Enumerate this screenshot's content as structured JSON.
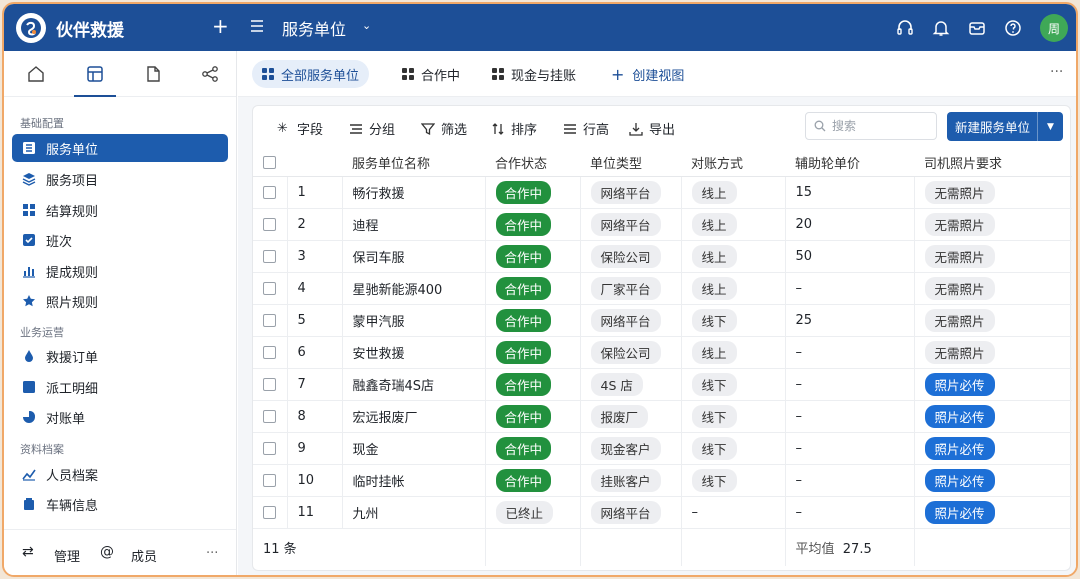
{
  "app": {
    "title": "伙伴救援",
    "view_title": "服务单位",
    "avatar": "周"
  },
  "colors": {
    "brand": "#1d4f97",
    "accent": "#1d5cad",
    "status_green": "#22913e",
    "photo_blue": "#1d6fd6"
  },
  "sidebar": {
    "tabs": [
      "home-icon",
      "table-icon",
      "document-icon",
      "share-icon"
    ],
    "sections": [
      {
        "title": "基础配置",
        "items": [
          {
            "label": "服务单位",
            "icon": "list-icon",
            "active": true
          },
          {
            "label": "服务项目",
            "icon": "layers-icon"
          },
          {
            "label": "结算规则",
            "icon": "grid-icon"
          },
          {
            "label": "班次",
            "icon": "checkbox-icon"
          },
          {
            "label": "提成规则",
            "icon": "bar-chart-icon"
          },
          {
            "label": "照片规则",
            "icon": "star-icon"
          }
        ]
      },
      {
        "title": "业务运营",
        "items": [
          {
            "label": "救援订单",
            "icon": "drop-icon"
          },
          {
            "label": "派工明细",
            "icon": "square-icon"
          },
          {
            "label": "对账单",
            "icon": "pie-icon"
          }
        ]
      },
      {
        "title": "资料档案",
        "items": [
          {
            "label": "人员档案",
            "icon": "trend-icon"
          },
          {
            "label": "车辆信息",
            "icon": "box-icon"
          }
        ]
      }
    ],
    "footer": {
      "manage": "管理",
      "members": "成员",
      "more": "···"
    }
  },
  "view_tabs": [
    {
      "label": "全部服务单位",
      "active": true
    },
    {
      "label": "合作中"
    },
    {
      "label": "现金与挂账"
    },
    {
      "label": "创建视图"
    }
  ],
  "toolbar": {
    "fields": "字段",
    "group": "分组",
    "filter": "筛选",
    "sort": "排序",
    "row_height": "行高",
    "export": "导出",
    "search_placeholder": "搜索",
    "new_button": "新建服务单位"
  },
  "table": {
    "columns": [
      "服务单位名称",
      "合作状态",
      "单位类型",
      "对账方式",
      "辅助轮单价",
      "司机照片要求"
    ],
    "rows": [
      {
        "no": "1",
        "name": "畅行救援",
        "status": "合作中",
        "type": "网络平台",
        "recon": "线上",
        "price": "15",
        "photo": "无需照片"
      },
      {
        "no": "2",
        "name": "迪程",
        "status": "合作中",
        "type": "网络平台",
        "recon": "线上",
        "price": "20",
        "photo": "无需照片"
      },
      {
        "no": "3",
        "name": "保司车服",
        "status": "合作中",
        "type": "保险公司",
        "recon": "线上",
        "price": "50",
        "photo": "无需照片"
      },
      {
        "no": "4",
        "name": "星驰新能源400",
        "status": "合作中",
        "type": "厂家平台",
        "recon": "线上",
        "price": "–",
        "photo": "无需照片"
      },
      {
        "no": "5",
        "name": "蒙甲汽服",
        "status": "合作中",
        "type": "网络平台",
        "recon": "线下",
        "price": "25",
        "photo": "无需照片"
      },
      {
        "no": "6",
        "name": "安世救援",
        "status": "合作中",
        "type": "保险公司",
        "recon": "线上",
        "price": "–",
        "photo": "无需照片"
      },
      {
        "no": "7",
        "name": "融鑫奇瑞4S店",
        "status": "合作中",
        "type": "4S 店",
        "recon": "线下",
        "price": "–",
        "photo": "照片必传"
      },
      {
        "no": "8",
        "name": "宏远报废厂",
        "status": "合作中",
        "type": "报废厂",
        "recon": "线下",
        "price": "–",
        "photo": "照片必传"
      },
      {
        "no": "9",
        "name": "现金",
        "status": "合作中",
        "type": "现金客户",
        "recon": "线下",
        "price": "–",
        "photo": "照片必传"
      },
      {
        "no": "10",
        "name": "临时挂帐",
        "status": "合作中",
        "type": "挂账客户",
        "recon": "线下",
        "price": "–",
        "photo": "照片必传"
      },
      {
        "no": "11",
        "name": "九州",
        "status": "已终止",
        "type": "网络平台",
        "recon": "–",
        "price": "–",
        "photo": "照片必传"
      }
    ],
    "footer": {
      "count": "11 条",
      "avg_label": "平均值",
      "avg_value": "27.5"
    }
  }
}
